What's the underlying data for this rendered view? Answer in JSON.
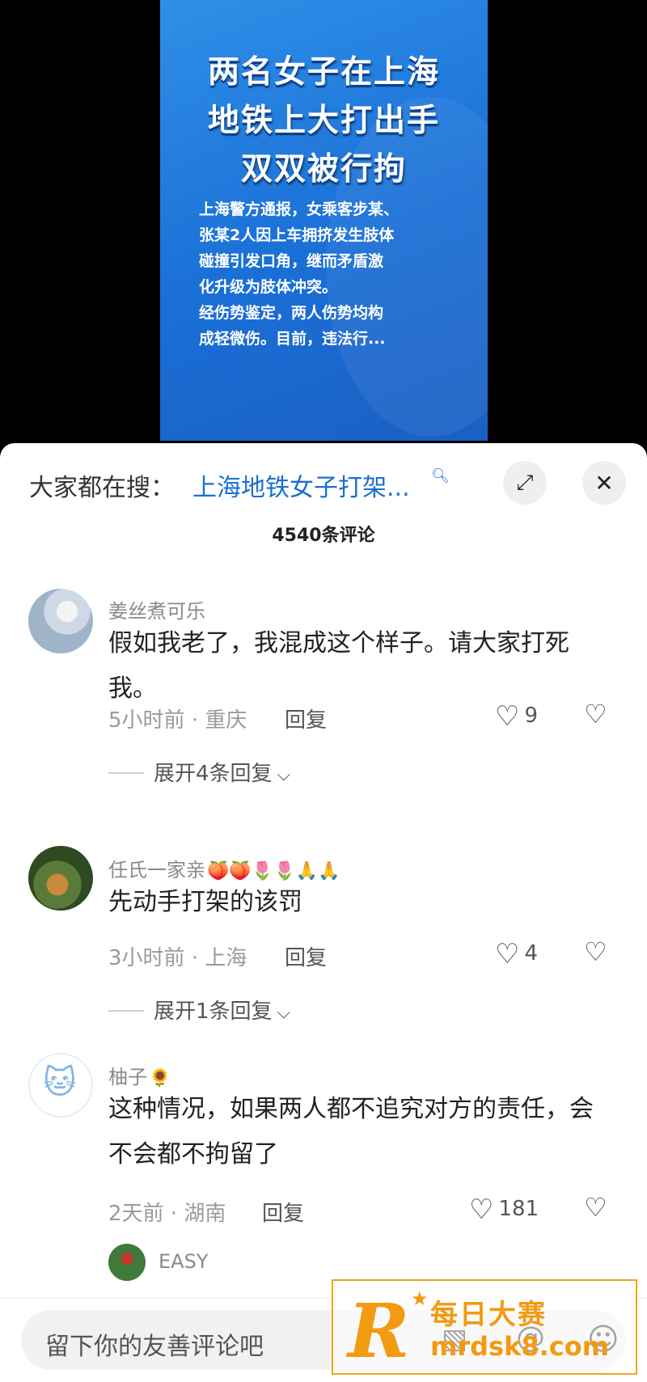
{
  "video": {
    "title_lines": [
      "两名女子在上海",
      "地铁上大打出手",
      "双双被行拘"
    ],
    "body_lines": [
      "上海警方通报，女乘客步某、",
      "张某2人因上车拥挤发生肢体",
      "碰撞引发口角，继而矛盾激",
      "化升级为肢体冲突。",
      "经伤势鉴定，两人伤势均构",
      "成轻微伤。目前，违法行..."
    ]
  },
  "search": {
    "label": "大家都在搜：",
    "query": "上海地铁女子打架...",
    "icon": "search-icon"
  },
  "header": {
    "comment_count": "4540条评论",
    "expand_icon": "expand-icon",
    "close_icon": "close-icon"
  },
  "comments": [
    {
      "username": "姜丝煮可乐",
      "text": "假如我老了，我混成这个样子。请大家打死我。",
      "time_location": "5小时前 · 重庆",
      "reply_label": "回复",
      "likes": "9",
      "expand_label": "展开4条回复"
    },
    {
      "username": "任氏一家亲",
      "name_emojis": "🍑🍑🌷🌷🙏🙏",
      "text": "先动手打架的该罚",
      "time_location": "3小时前 · 上海",
      "reply_label": "回复",
      "likes": "4",
      "expand_label": "展开1条回复"
    },
    {
      "username": "柚子",
      "name_emojis": "🌻",
      "text": "这种情况，如果两人都不追究对方的责任，会不会都不拘留了",
      "time_location": "2天前 · 湖南",
      "reply_label": "回复",
      "likes": "181"
    },
    {
      "username": "EASY"
    }
  ],
  "composer": {
    "placeholder": "留下你的友善评论吧"
  },
  "watermark": {
    "brand": "每日大赛",
    "domain": "mrdsk8.com"
  },
  "colors": {
    "video_bg": "#1f74da",
    "link": "#1a6fd0",
    "watermark": "#f29a12"
  }
}
